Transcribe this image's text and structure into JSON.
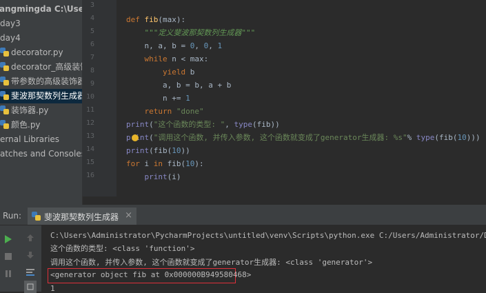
{
  "sidebar": {
    "items": [
      {
        "label": "angmingda  C:\\Users\\Ad",
        "kind": "root"
      },
      {
        "label": "day3",
        "kind": "folder"
      },
      {
        "label": "day4",
        "kind": "folder"
      },
      {
        "label": "decorator.py",
        "kind": "py"
      },
      {
        "label": "decorator_高级装饰器.py",
        "kind": "py"
      },
      {
        "label": "带参数的高级装饰器.py",
        "kind": "py"
      },
      {
        "label": "斐波那契数列生成器.py",
        "kind": "py",
        "selected": true
      },
      {
        "label": "装饰器.py",
        "kind": "py"
      },
      {
        "label": "颜色.py",
        "kind": "py"
      },
      {
        "label": "ernal Libraries",
        "kind": "lib"
      },
      {
        "label": "atches and Consoles",
        "kind": "scratch"
      }
    ]
  },
  "editor": {
    "line_numbers": [
      "3",
      "4",
      "5",
      "6",
      "7",
      "8",
      "9",
      "10",
      "11",
      "12",
      "13",
      "14",
      "15",
      "16"
    ],
    "lines": [
      [],
      [
        {
          "t": "def ",
          "c": "kw"
        },
        {
          "t": "fib",
          "c": "fn"
        },
        {
          "t": "(max):",
          "c": ""
        }
      ],
      [
        {
          "t": "    \"\"\"定义斐波那契数列生成器\"\"\"",
          "c": "cm"
        }
      ],
      [
        {
          "t": "    n, a, b = ",
          "c": ""
        },
        {
          "t": "0",
          "c": "num"
        },
        {
          "t": ", ",
          "c": ""
        },
        {
          "t": "0",
          "c": "num"
        },
        {
          "t": ", ",
          "c": ""
        },
        {
          "t": "1",
          "c": "num"
        }
      ],
      [
        {
          "t": "    ",
          "c": ""
        },
        {
          "t": "while ",
          "c": "kw"
        },
        {
          "t": "n < max:",
          "c": ""
        }
      ],
      [
        {
          "t": "        ",
          "c": ""
        },
        {
          "t": "yield ",
          "c": "kw"
        },
        {
          "t": "b",
          "c": ""
        }
      ],
      [
        {
          "t": "        a, b = b, a + b",
          "c": ""
        }
      ],
      [
        {
          "t": "        n += ",
          "c": ""
        },
        {
          "t": "1",
          "c": "num"
        }
      ],
      [
        {
          "t": "    ",
          "c": ""
        },
        {
          "t": "return ",
          "c": "kw"
        },
        {
          "t": "\"done\"",
          "c": "str"
        }
      ],
      [
        {
          "t": "print",
          "c": "bi"
        },
        {
          "t": "(",
          "c": ""
        },
        {
          "t": "\"这个函数的类型: \"",
          "c": "str"
        },
        {
          "t": ", ",
          "c": ""
        },
        {
          "t": "type",
          "c": "bi"
        },
        {
          "t": "(fib))",
          "c": ""
        }
      ],
      [
        {
          "t": "print",
          "c": "bi"
        },
        {
          "t": "(",
          "c": ""
        },
        {
          "t": "\"调用这个函数, 并传入参数, 这个函数就变成了generator生成器: %s\"",
          "c": "str"
        },
        {
          "t": "% ",
          "c": ""
        },
        {
          "t": "type",
          "c": "bi"
        },
        {
          "t": "(fib(",
          "c": ""
        },
        {
          "t": "10",
          "c": "num"
        },
        {
          "t": ")))",
          "c": ""
        }
      ],
      [
        {
          "t": "print",
          "c": "bi"
        },
        {
          "t": "(fib(",
          "c": ""
        },
        {
          "t": "10",
          "c": "num"
        },
        {
          "t": "))",
          "c": ""
        }
      ],
      [
        {
          "t": "for ",
          "c": "kw"
        },
        {
          "t": "i ",
          "c": ""
        },
        {
          "t": "in ",
          "c": "kw"
        },
        {
          "t": "fib(",
          "c": ""
        },
        {
          "t": "10",
          "c": "num"
        },
        {
          "t": "):",
          "c": ""
        }
      ],
      [
        {
          "t": "    ",
          "c": ""
        },
        {
          "t": "print",
          "c": "bi"
        },
        {
          "t": "(i)",
          "c": ""
        }
      ],
      []
    ]
  },
  "run": {
    "label": "Run:",
    "tab_label": "斐波那契数列生成器",
    "close": "×"
  },
  "console": {
    "lines": [
      "C:\\Users\\Administrator\\PycharmProjects\\untitled\\venv\\Scripts\\python.exe C:/Users/Administrator/Desktop/zh",
      "这个函数的类型: <class 'function'>",
      "调用这个函数, 并传入参数, 这个函数就变成了generator生成器: <class 'generator'>",
      "<generator object fib at 0x000000B949580468>",
      "1"
    ]
  },
  "icons": {
    "run": "play-icon",
    "stop": "stop-icon",
    "pause": "pause-icon",
    "up": "arrow-up-icon",
    "down": "arrow-down-icon",
    "wrap": "soft-wrap-icon",
    "settings": "settings-icon"
  },
  "colors": {
    "keyword": "#cc7832",
    "function": "#ffc66d",
    "string": "#6a8759",
    "number": "#6897bb",
    "builtin": "#8888c6",
    "highlight_border": "#e0303a",
    "run_green": "#4cae4f"
  }
}
